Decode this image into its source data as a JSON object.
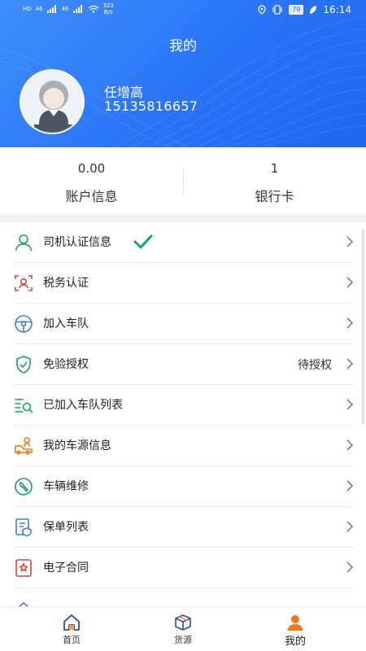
{
  "status_bar": {
    "network_badges": [
      "HD",
      "46",
      "46"
    ],
    "speed_value": "323",
    "speed_unit": "B/s",
    "battery": "79",
    "time": "16:14"
  },
  "header": {
    "title": "我的",
    "user_name": "任增高",
    "user_phone": "15135816657"
  },
  "stats": [
    {
      "value": "0.00",
      "label": "账户信息"
    },
    {
      "value": "1",
      "label": "银行卡"
    }
  ],
  "menu": {
    "items": [
      {
        "label": "司机认证信息",
        "icon": "person-icon",
        "verified": true
      },
      {
        "label": "税务认证",
        "icon": "scan-face-icon"
      },
      {
        "label": "加入车队",
        "icon": "steering-wheel-icon"
      },
      {
        "label": "免验授权",
        "icon": "shield-check-icon",
        "status": "待授权"
      },
      {
        "label": "已加入车队列表",
        "icon": "search-list-icon"
      },
      {
        "label": "我的车源信息",
        "icon": "truck-person-icon"
      },
      {
        "label": "车辆维修",
        "icon": "wrench-icon"
      },
      {
        "label": "保单列表",
        "icon": "policy-icon"
      },
      {
        "label": "电子合同",
        "icon": "contract-icon"
      }
    ]
  },
  "tabbar": {
    "tabs": [
      {
        "label": "首页",
        "icon": "home-icon"
      },
      {
        "label": "货源",
        "icon": "box-icon"
      },
      {
        "label": "我的",
        "icon": "user-icon",
        "active": true
      }
    ]
  },
  "colors": {
    "primary": "#2a73f5",
    "green": "#1aa35a",
    "red": "#e0443a",
    "blue_icon": "#3d7fd6",
    "orange": "#f07a1a"
  }
}
